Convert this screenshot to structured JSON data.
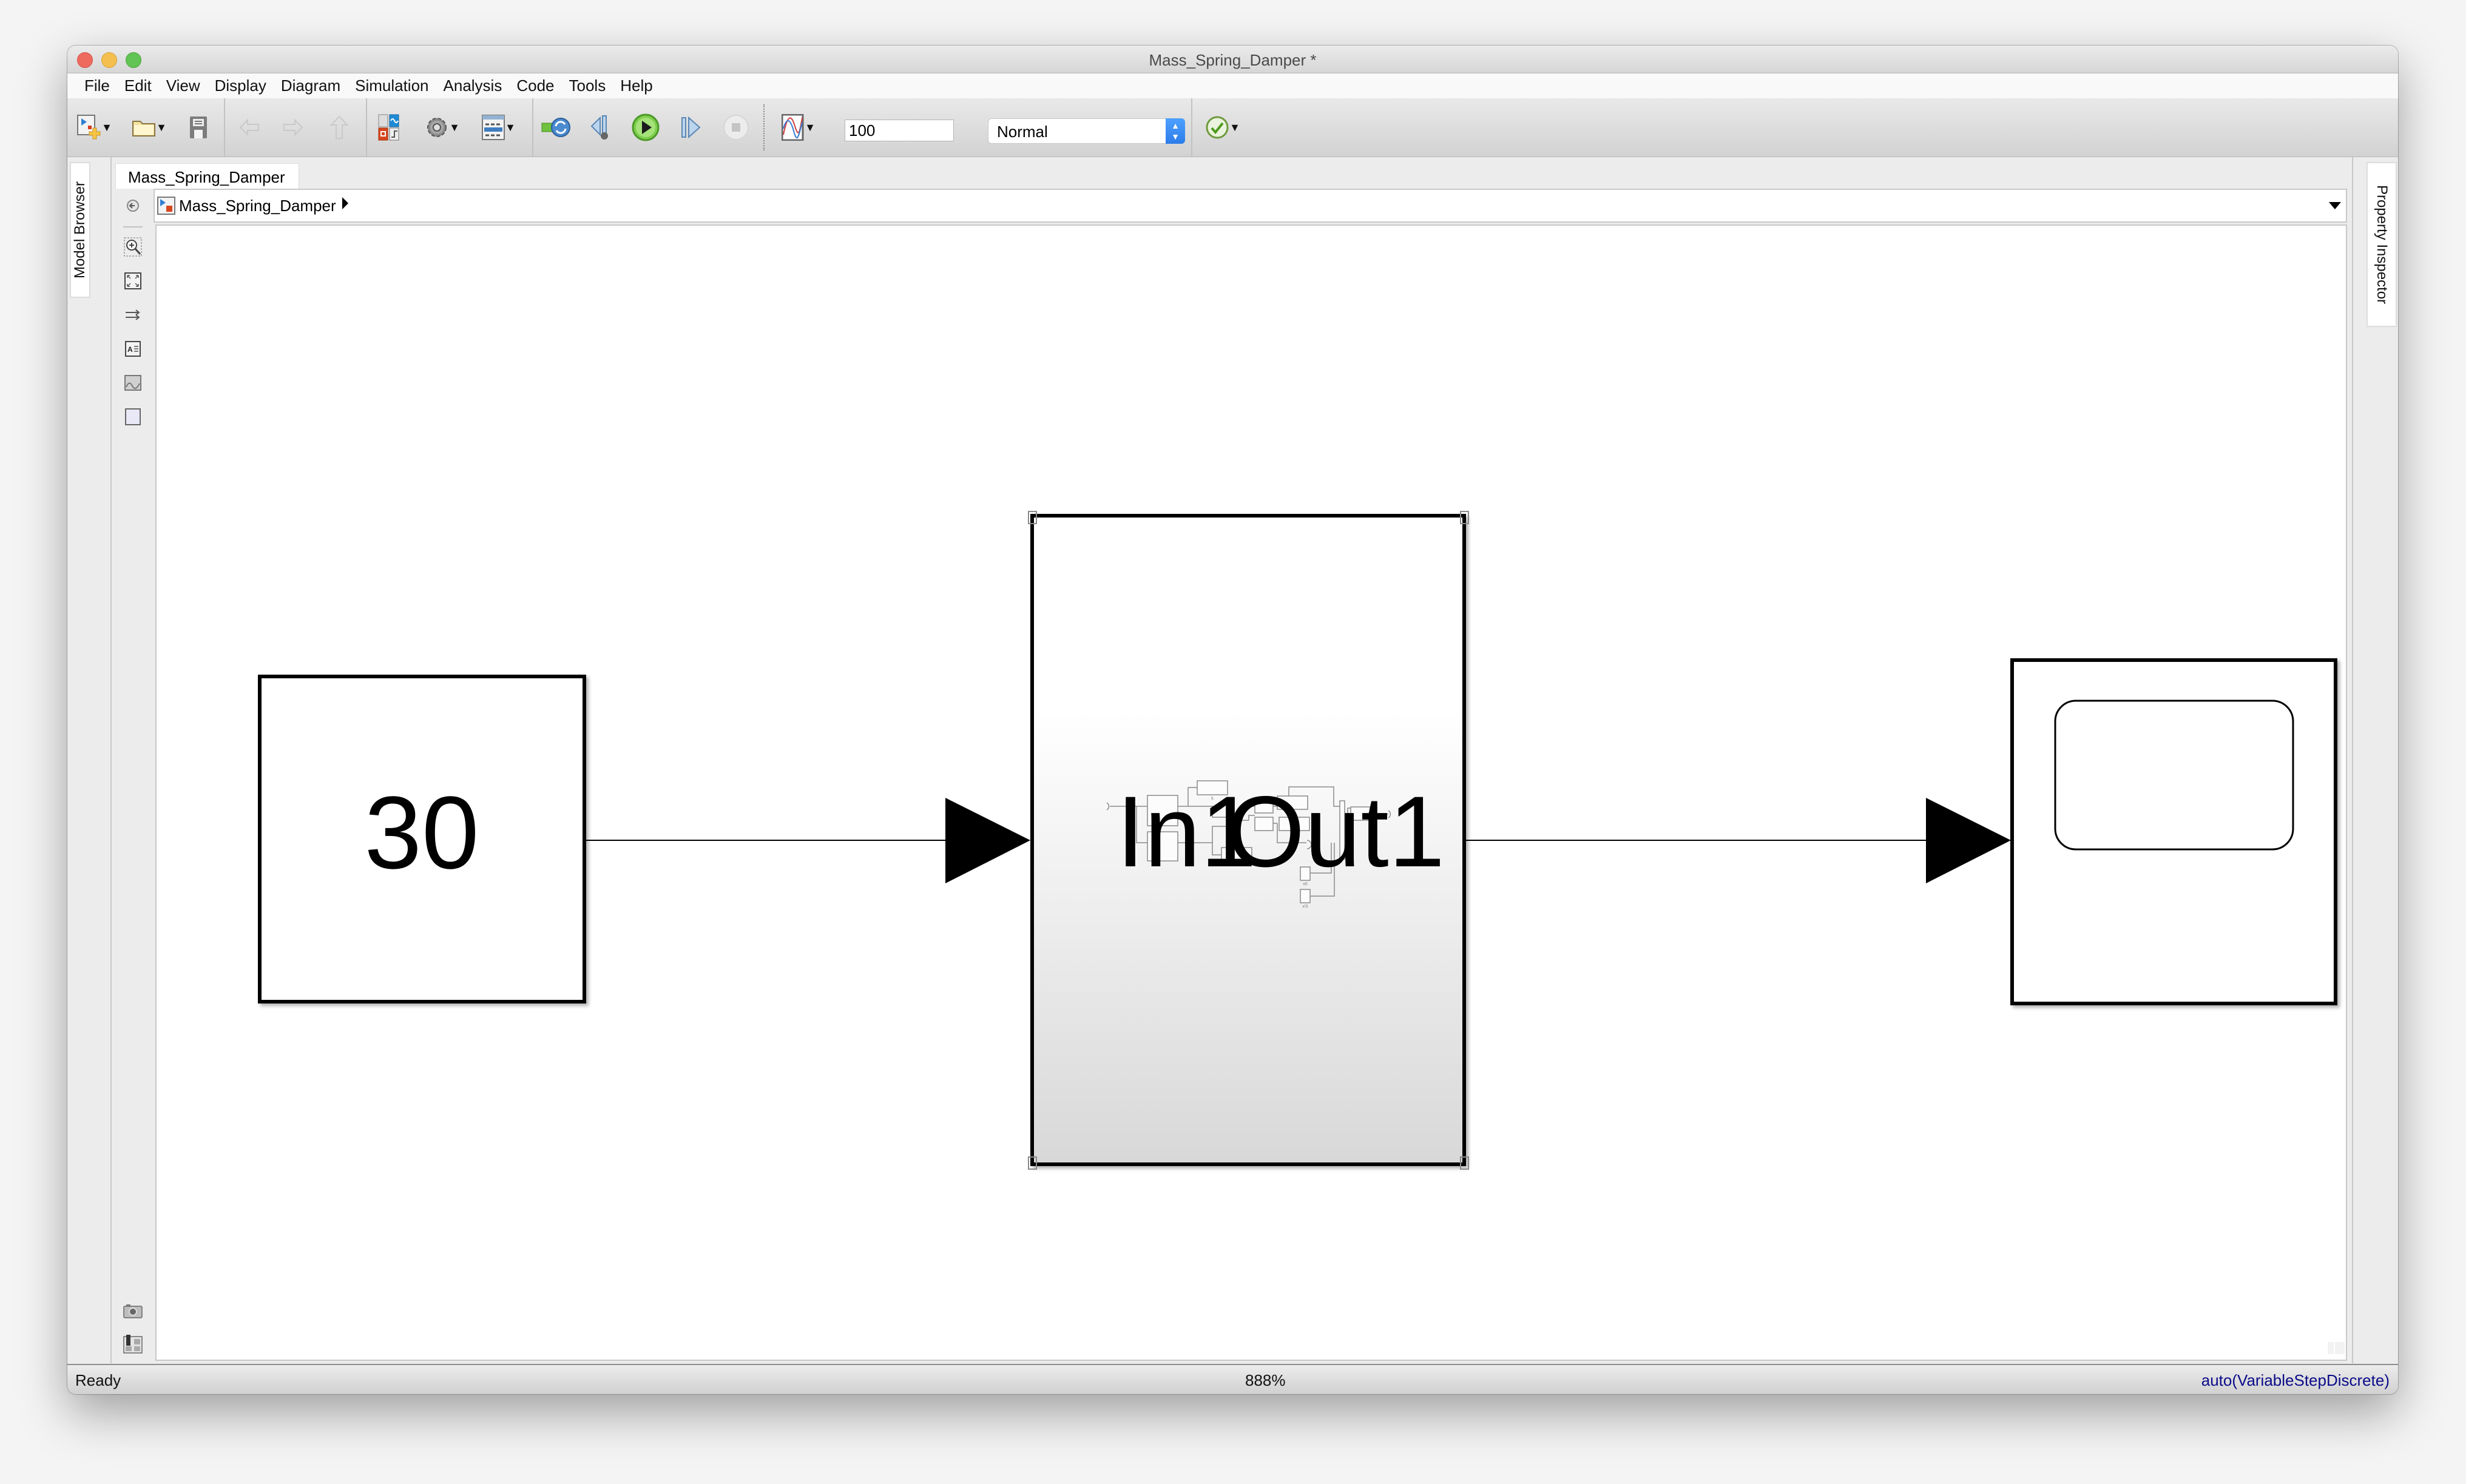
{
  "window": {
    "title": "Mass_Spring_Damper *"
  },
  "menu": [
    {
      "label": "File"
    },
    {
      "label": "Edit"
    },
    {
      "label": "View"
    },
    {
      "label": "Display"
    },
    {
      "label": "Diagram"
    },
    {
      "label": "Simulation"
    },
    {
      "label": "Analysis"
    },
    {
      "label": "Code"
    },
    {
      "label": "Tools"
    },
    {
      "label": "Help"
    }
  ],
  "toolbar": {
    "buttons": [
      {
        "name": "new-model",
        "icon": "new-model-icon",
        "has_dropdown": true,
        "enabled": true
      },
      {
        "name": "open",
        "icon": "folder-icon",
        "has_dropdown": true,
        "enabled": true
      },
      {
        "name": "save",
        "icon": "save-icon",
        "enabled": true
      },
      {
        "name": "back",
        "icon": "arrow-left-icon",
        "enabled": false
      },
      {
        "name": "forward",
        "icon": "arrow-right-icon",
        "enabled": false
      },
      {
        "name": "up",
        "icon": "arrow-up-icon",
        "enabled": false
      },
      {
        "name": "library-browser",
        "icon": "library-browser-icon",
        "enabled": true
      },
      {
        "name": "model-configuration",
        "icon": "gear-icon",
        "has_dropdown": true,
        "enabled": true
      },
      {
        "name": "model-explorer",
        "icon": "model-explorer-icon",
        "has_dropdown": true,
        "enabled": true
      },
      {
        "name": "update-diagram",
        "icon": "refresh-icon",
        "enabled": true
      },
      {
        "name": "step-back",
        "icon": "step-back-icon",
        "enabled": true
      },
      {
        "name": "run",
        "icon": "play-icon",
        "enabled": true
      },
      {
        "name": "step-forward",
        "icon": "step-forward-icon",
        "enabled": true
      },
      {
        "name": "stop",
        "icon": "stop-icon",
        "enabled": false
      },
      {
        "name": "data-inspector",
        "icon": "data-inspector-icon",
        "has_dropdown": true,
        "enabled": true
      },
      {
        "name": "model-advisor",
        "icon": "check-icon",
        "has_dropdown": true,
        "enabled": true
      }
    ],
    "stop_time": "100",
    "simulation_mode": "Normal"
  },
  "side_panels": {
    "left": "Model Browser",
    "right": "Property Inspector"
  },
  "tabs": [
    {
      "label": "Mass_Spring_Damper",
      "active": true
    }
  ],
  "breadcrumb": {
    "items": [
      {
        "label": "Mass_Spring_Damper"
      }
    ]
  },
  "palette": {
    "top": [
      "hide-browser-icon",
      "zoom-icon",
      "fit-view-icon",
      "route-lines-icon",
      "annotation-icon",
      "image-icon",
      "area-icon"
    ],
    "bottom": [
      "screenshot-icon",
      "viewmarks-icon",
      "collapse-icon"
    ]
  },
  "diagram": {
    "blocks": [
      {
        "id": "constant",
        "type": "Constant",
        "value": "30"
      },
      {
        "id": "subsystem",
        "type": "Subsystem",
        "input_port_label": "In1",
        "output_port_label": "Out1",
        "selected": true,
        "thumbnail_labels": [
          "k",
          "Wn",
          "Zeta",
          "b",
          "x0",
          "x'0"
        ]
      },
      {
        "id": "scope",
        "type": "Scope"
      }
    ],
    "lines": [
      {
        "from": "constant",
        "to": "subsystem"
      },
      {
        "from": "subsystem",
        "to": "scope"
      }
    ]
  },
  "status": {
    "left": "Ready",
    "zoom": "888%",
    "solver": "auto(VariableStepDiscrete)"
  },
  "colors": {
    "solver_text": "#0b0b8a",
    "run_green": "#6cc04a",
    "mode_stepper": "#2b7ce9"
  }
}
